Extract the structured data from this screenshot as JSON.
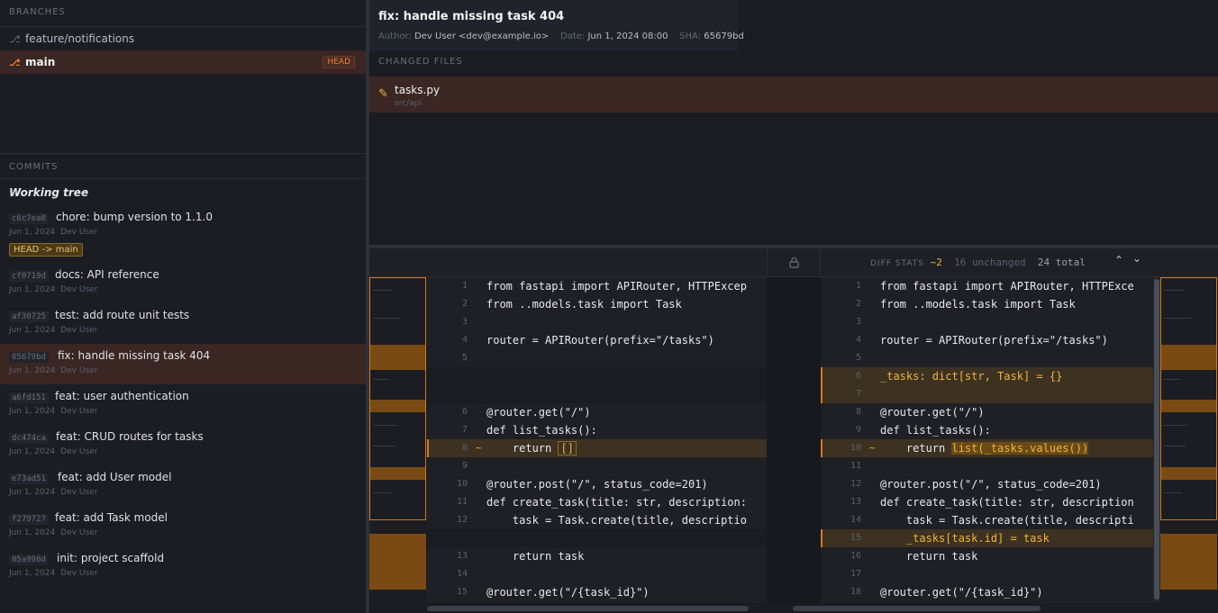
{
  "sidebar": {
    "branches_label": "BRANCHES",
    "branches": [
      {
        "name": "feature/notifications"
      },
      {
        "name": "main",
        "badge": "HEAD"
      }
    ],
    "commits_label": "COMMITS",
    "working_tree": "Working tree",
    "head_ref_badge": "HEAD -> main",
    "commits": [
      {
        "sha": "c6c7ea8",
        "message": "chore: bump version to 1.1.0",
        "date": "Jun 1, 2024",
        "author": "Dev User"
      },
      {
        "sha": "cf0719d",
        "message": "docs: API reference",
        "date": "Jun 1, 2024",
        "author": "Dev User"
      },
      {
        "sha": "af30725",
        "message": "test: add route unit tests",
        "date": "Jun 1, 2024",
        "author": "Dev User"
      },
      {
        "sha": "65679bd",
        "message": "fix: handle missing task 404",
        "date": "Jun 1, 2024",
        "author": "Dev User"
      },
      {
        "sha": "a6fd151",
        "message": "feat: user authentication",
        "date": "Jun 1, 2024",
        "author": "Dev User"
      },
      {
        "sha": "dc474ca",
        "message": "feat: CRUD routes for tasks",
        "date": "Jun 1, 2024",
        "author": "Dev User"
      },
      {
        "sha": "e73ad51",
        "message": "feat: add User model",
        "date": "Jun 1, 2024",
        "author": "Dev User"
      },
      {
        "sha": "f279727",
        "message": "feat: add Task model",
        "date": "Jun 1, 2024",
        "author": "Dev User"
      },
      {
        "sha": "05a998d",
        "message": "init: project scaffold",
        "date": "Jun 1, 2024",
        "author": "Dev User"
      }
    ]
  },
  "commit": {
    "title": "fix: handle missing task 404",
    "author_label": "Author:",
    "author": "Dev User <dev@example.io>",
    "date_label": "Date:",
    "date": "Jun 1, 2024 08:00",
    "sha_label": "SHA:",
    "sha": "65679bd"
  },
  "changed_files": {
    "label": "CHANGED FILES",
    "files": [
      {
        "name": "tasks.py",
        "dir": "src/api",
        "icon": "pencil-icon"
      }
    ]
  },
  "diff": {
    "stats_label": "DIFF STATS",
    "changed": "~2",
    "unchanged": "16 unchanged",
    "total": "24 total",
    "left": [
      {
        "n": "1",
        "code": "from fastapi import APIRouter, HTTPExcep"
      },
      {
        "n": "2",
        "code": "from ..models.task import Task"
      },
      {
        "n": "3",
        "code": ""
      },
      {
        "n": "4",
        "code": "router = APIRouter(prefix=\"/tasks\")"
      },
      {
        "n": "5",
        "code": ""
      },
      {
        "n": "",
        "code": "",
        "kind": "pad"
      },
      {
        "n": "",
        "code": "",
        "kind": "pad"
      },
      {
        "n": "6",
        "code": "@router.get(\"/\")"
      },
      {
        "n": "7",
        "code": "def list_tasks():"
      },
      {
        "n": "8",
        "code": "    return []",
        "kind": "chg",
        "mark": "~",
        "pre": "    return ",
        "hl": "[]"
      },
      {
        "n": "9",
        "code": ""
      },
      {
        "n": "10",
        "code": "@router.post(\"/\", status_code=201)"
      },
      {
        "n": "11",
        "code": "def create_task(title: str, description:"
      },
      {
        "n": "12",
        "code": "    task = Task.create(title, descriptio"
      },
      {
        "n": "",
        "code": "",
        "kind": "pad"
      },
      {
        "n": "13",
        "code": "    return task"
      },
      {
        "n": "14",
        "code": ""
      },
      {
        "n": "15",
        "code": "@router.get(\"/{task_id}\")"
      }
    ],
    "right": [
      {
        "n": "1",
        "code": "from fastapi import APIRouter, HTTPExce"
      },
      {
        "n": "2",
        "code": "from ..models.task import Task"
      },
      {
        "n": "3",
        "code": ""
      },
      {
        "n": "4",
        "code": "router = APIRouter(prefix=\"/tasks\")"
      },
      {
        "n": "5",
        "code": ""
      },
      {
        "n": "6",
        "code": "_tasks: dict[str, Task] = {}",
        "kind": "add"
      },
      {
        "n": "7",
        "code": "",
        "kind": "add"
      },
      {
        "n": "8",
        "code": "@router.get(\"/\")"
      },
      {
        "n": "9",
        "code": "def list_tasks():"
      },
      {
        "n": "10",
        "code": "    return list(_tasks.values())",
        "kind": "chg",
        "mark": "~",
        "pre": "    return ",
        "hl": "list(_tasks.values())"
      },
      {
        "n": "11",
        "code": ""
      },
      {
        "n": "12",
        "code": "@router.post(\"/\", status_code=201)"
      },
      {
        "n": "13",
        "code": "def create_task(title: str, description"
      },
      {
        "n": "14",
        "code": "    task = Task.create(title, descripti"
      },
      {
        "n": "15",
        "code": "    _tasks[task.id] = task",
        "kind": "add"
      },
      {
        "n": "16",
        "code": "    return task"
      },
      {
        "n": "17",
        "code": ""
      },
      {
        "n": "18",
        "code": "@router.get(\"/{task_id}\")"
      }
    ]
  }
}
